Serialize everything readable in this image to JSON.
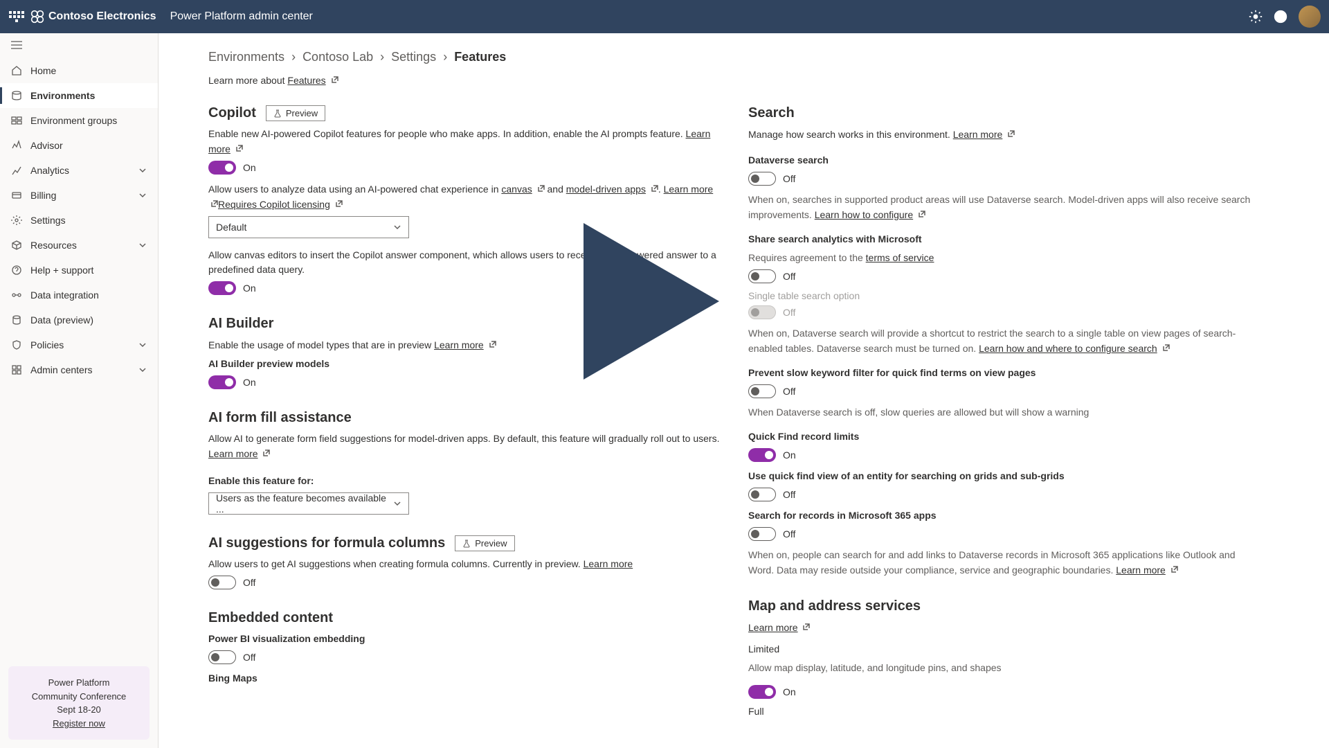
{
  "header": {
    "org": "Contoso Electronics",
    "app": "Power Platform admin center"
  },
  "sidebar": {
    "items": [
      {
        "label": "Home"
      },
      {
        "label": "Environments"
      },
      {
        "label": "Environment groups"
      },
      {
        "label": "Advisor"
      },
      {
        "label": "Analytics"
      },
      {
        "label": "Billing"
      },
      {
        "label": "Settings"
      },
      {
        "label": "Resources"
      },
      {
        "label": "Help + support"
      },
      {
        "label": "Data integration"
      },
      {
        "label": "Data (preview)"
      },
      {
        "label": "Policies"
      },
      {
        "label": "Admin centers"
      }
    ],
    "promo": {
      "line1": "Power Platform",
      "line2": "Community Conference",
      "line3": "Sept 18-20",
      "link": "Register now"
    }
  },
  "crumbs": {
    "c1": "Environments",
    "c2": "Contoso Lab",
    "c3": "Settings",
    "c4": "Features"
  },
  "learn_about": {
    "prefix": "Learn more about ",
    "link": "Features"
  },
  "copilot": {
    "title": "Copilot",
    "preview": "Preview",
    "desc1a": "Enable new AI-powered Copilot features for people who make apps. In addition, enable the AI prompts feature. ",
    "learn_more": "Learn more",
    "toggle1": "On",
    "desc2a": "Allow users to analyze data using an AI-powered chat experience in ",
    "canvas": "canvas",
    "and": " and ",
    "mda": "model-driven apps",
    "dot": ". ",
    "requires": "Requires Copilot licensing",
    "select": "Default",
    "desc3": "Allow canvas editors to insert the Copilot answer component, which allows users to receive an AI-powered answer to a predefined data query.",
    "toggle3": "On"
  },
  "aibuilder": {
    "title": "AI Builder",
    "desc": "Enable the usage of model types that are in preview ",
    "learn": "Learn more",
    "label": "AI Builder preview models",
    "toggle": "On"
  },
  "formfill": {
    "title": "AI form fill assistance",
    "desc": "Allow AI to generate form field suggestions for model-driven apps. By default, this feature will gradually roll out to users. ",
    "learn": "Learn more",
    "label": "Enable this feature for:",
    "select": "Users as the feature becomes available ..."
  },
  "formula": {
    "title": "AI suggestions for formula columns",
    "preview": "Preview",
    "desc": "Allow users to get AI suggestions when creating formula columns. Currently in preview. ",
    "learn": "Learn more",
    "toggle": "Off"
  },
  "embedded": {
    "title": "Embedded content",
    "pbi_label": "Power BI visualization embedding",
    "pbi_toggle": "Off",
    "bing": "Bing Maps"
  },
  "search": {
    "title": "Search",
    "desc": "Manage how search works in this environment. ",
    "learn": "Learn more",
    "dv_label": "Dataverse search",
    "dv_toggle": "Off",
    "dv_desc": "When on, searches in supported product areas will use Dataverse search. Model-driven apps will also receive search improvements. ",
    "dv_learn": "Learn how to configure",
    "share_label": "Share search analytics with Microsoft",
    "share_req": "Requires agreement to the ",
    "tos": "terms of service",
    "share_toggle": "Off",
    "single_label": "Single table search option",
    "single_toggle": "Off",
    "single_desc": "When on, Dataverse search will provide a shortcut to restrict the search to a single table on view pages of search-enabled tables. Dataverse search must be turned on. ",
    "single_learn": "Learn how and where to configure search",
    "slow_label": "Prevent slow keyword filter for quick find terms on view pages",
    "slow_toggle": "Off",
    "slow_desc": "When Dataverse search is off, slow queries are allowed but will show a warning",
    "qf_label": "Quick Find record limits",
    "qf_toggle": "On",
    "qfv_label": "Use quick find view of an entity for searching on grids and sub-grids",
    "qfv_toggle": "Off",
    "m365_label": "Search for records in Microsoft 365 apps",
    "m365_toggle": "Off",
    "m365_desc": "When on, people can search for and add links to Dataverse records in Microsoft 365 applications like Outlook and Word. Data may reside outside your compliance, service and geographic boundaries. ",
    "m365_learn": "Learn more"
  },
  "map": {
    "title": "Map and address services",
    "learn": "Learn more",
    "limited": "Limited",
    "limited_desc": "Allow map display, latitude, and longitude pins, and shapes",
    "limited_toggle": "On",
    "full": "Full"
  }
}
